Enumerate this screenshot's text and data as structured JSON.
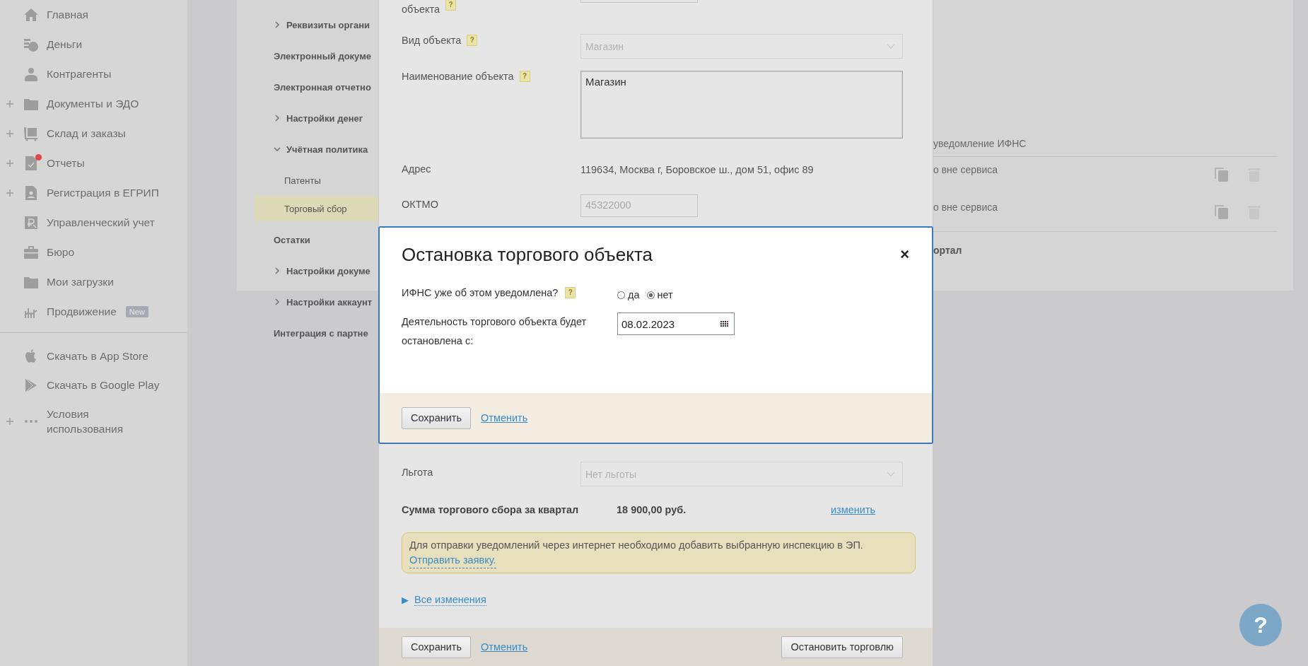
{
  "sidebar": {
    "items": [
      {
        "label": "Главная",
        "expandable": false,
        "notification": false
      },
      {
        "label": "Деньги",
        "expandable": false,
        "notification": false
      },
      {
        "label": "Контрагенты",
        "expandable": false,
        "notification": false
      },
      {
        "label": "Документы и ЭДО",
        "expandable": true,
        "notification": false
      },
      {
        "label": "Склад и заказы",
        "expandable": true,
        "notification": false
      },
      {
        "label": "Отчеты",
        "expandable": true,
        "notification": true
      },
      {
        "label": "Регистрация в ЕГРИП",
        "expandable": true,
        "notification": false
      },
      {
        "label": "Управленческий учет",
        "expandable": false,
        "notification": false
      },
      {
        "label": "Бюро",
        "expandable": false,
        "notification": false
      },
      {
        "label": "Мои загрузки",
        "expandable": false,
        "notification": false
      },
      {
        "label": "Продвижение",
        "expandable": false,
        "notification": false,
        "badge": "New"
      }
    ],
    "bottom_items": [
      {
        "label": "Скачать в App Store",
        "expandable": false
      },
      {
        "label": "Скачать в Google Play",
        "expandable": false
      },
      {
        "label": "Условия\nиспользования",
        "expandable": true
      }
    ]
  },
  "settings_nav": {
    "items": [
      {
        "label": "Реквизиты органи",
        "kind": "group",
        "expanded": false
      },
      {
        "label": "Электронный докуме",
        "kind": "item"
      },
      {
        "label": "Электронная отчетно",
        "kind": "item"
      },
      {
        "label": "Настройки денег",
        "kind": "group",
        "expanded": false
      },
      {
        "label": "Учётная политика",
        "kind": "group",
        "expanded": true
      },
      {
        "label": "Патенты",
        "kind": "sub",
        "selected": false
      },
      {
        "label": "Торговый сбор",
        "kind": "sub",
        "selected": true
      },
      {
        "label": "Остатки",
        "kind": "item"
      },
      {
        "label": "Настройки докуме",
        "kind": "group",
        "expanded": false
      },
      {
        "label": "Настройки аккаунт",
        "kind": "group",
        "expanded": false
      },
      {
        "label": "Интеграция с партне",
        "kind": "item"
      }
    ]
  },
  "table_fragment": {
    "header": "уведомление ИФНС",
    "rows": [
      {
        "status": "о вне сервиса"
      },
      {
        "status": "о вне сервиса"
      }
    ],
    "footer": "ортал"
  },
  "back_form": {
    "rows": [
      {
        "kind": "field",
        "label": "объекта",
        "hint": "?"
      },
      {
        "kind": "select",
        "label": "Вид объекта",
        "hint": "?",
        "value": "Магазин",
        "disabled": true
      },
      {
        "kind": "textarea",
        "label": "Наименование объекта",
        "hint": "?",
        "value": "Магазин"
      },
      {
        "kind": "text",
        "label": "Адрес",
        "value": "119634, Москва г, Боровское ш., дом 51, офис 89"
      },
      {
        "kind": "input",
        "label": "ОКТМО",
        "value": "45322000",
        "disabled": true
      }
    ],
    "lower_rows": [
      {
        "kind": "select",
        "label": "Льгота",
        "value": "Нет льготы",
        "disabled": true
      }
    ],
    "total": {
      "label": "Сумма торгового сбора за квартал",
      "value": "18 900,00 руб.",
      "link": "изменить"
    },
    "notice": {
      "text": "Для отправки уведомлений через интернет необходимо добавить выбранную инспекцию в ЭП.",
      "link": "Отправить заявку."
    },
    "history": {
      "marker": "▶",
      "link": "Все изменения"
    },
    "footer": {
      "save": "Сохранить",
      "cancel": "Отменить",
      "stop": "Остановить торговлю"
    }
  },
  "modal": {
    "title": "Остановка торгового объекта",
    "close": "×",
    "question": {
      "label": "ИФНС уже об этом уведомлена?",
      "hint": "?",
      "options": [
        {
          "label": "да",
          "selected": false
        },
        {
          "label": "нет",
          "selected": true
        }
      ]
    },
    "date": {
      "label": "Деятельность торгового объекта будет остановлена с:",
      "value": "08.02.2023"
    },
    "footer": {
      "save": "Сохранить",
      "cancel": "Отменить"
    }
  },
  "help_button": {
    "label": "?"
  }
}
